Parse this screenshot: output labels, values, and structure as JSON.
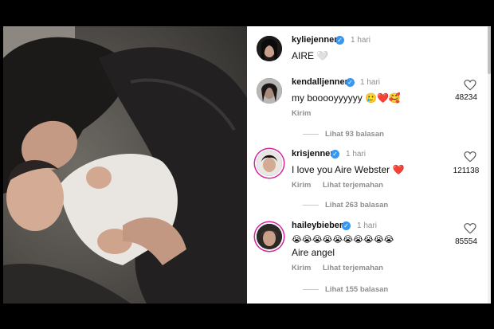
{
  "comments": [
    {
      "username": "kyliejenner",
      "time": "1 hari",
      "text": "AIRE 🤍",
      "verified_icon": "verified-badge-icon"
    },
    {
      "username": "kendalljenner",
      "time": "1 hari",
      "text": "my booooyyyyyy 🥲❤️🥰",
      "likes": "48234",
      "actions": [
        "Kirim"
      ],
      "replies": "Lihat 93 balasan"
    },
    {
      "username": "krisjenner",
      "time": "1 hari",
      "text": "I love you Aire Webster ❤️",
      "likes": "121138",
      "actions": [
        "Kirim",
        "Lihat terjemahan"
      ],
      "replies": "Lihat 263 balasan"
    },
    {
      "username": "haileybieber",
      "time": "1 hari",
      "text_emoji": "😭😭😭😭😭😭😭😭😭😭",
      "text": "Aire angel",
      "likes": "85554",
      "actions": [
        "Kirim",
        "Lihat terjemahan"
      ],
      "replies": "Lihat 155 balasan"
    }
  ],
  "colors": {
    "accent_blue": "#3897f0",
    "story_ring": "#d6249f",
    "muted_text": "#8e8e8e"
  }
}
